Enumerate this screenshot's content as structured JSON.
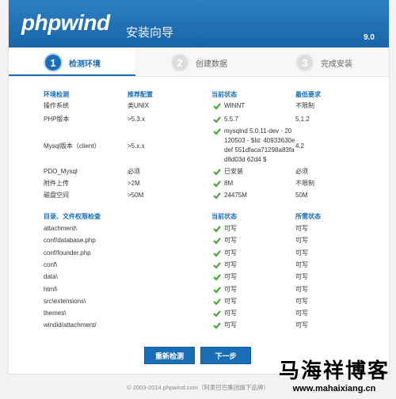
{
  "header": {
    "logo": "phpwind",
    "title": "安装向导",
    "version": "9.0"
  },
  "steps": [
    {
      "num": "1",
      "label": "检测环境"
    },
    {
      "num": "2",
      "label": "创建数据"
    },
    {
      "num": "3",
      "label": "完成安装"
    }
  ],
  "env": {
    "headers": [
      "环境检测",
      "推荐配置",
      "当前状态",
      "最低要求"
    ],
    "rows": [
      {
        "name": "操作系统",
        "rec": "类UNIX",
        "cur": "WINNT",
        "min": "不限制"
      },
      {
        "name": "PHP版本",
        "rec": ">5.3.x",
        "cur": "5.5.7",
        "min": "5.1.2"
      },
      {
        "name": "Mysql版本（client）",
        "rec": ">5.x.x",
        "cur": "mysqlnd 5.0.11-dev - 20 120503 - $Id: 40933630edef 551dfaca71298a83fad8d03d 62d4 $",
        "min": "4.2"
      },
      {
        "name": "PDO_Mysql",
        "rec": "必须",
        "cur": "已安装",
        "min": "必须"
      },
      {
        "name": "附件上传",
        "rec": ">2M",
        "cur": "8M",
        "min": "不限制"
      },
      {
        "name": "磁盘空间",
        "rec": ">50M",
        "cur": "24475M",
        "min": "50M"
      }
    ]
  },
  "perm": {
    "headers": [
      "目录、文件权限检查",
      "当前状态",
      "所需状态"
    ],
    "rows": [
      {
        "path": "attachment\\",
        "cur": "可写",
        "req": "可写"
      },
      {
        "path": "conf/database.php",
        "cur": "可写",
        "req": "可写"
      },
      {
        "path": "conf/founder.php",
        "cur": "可写",
        "req": "可写"
      },
      {
        "path": "conf\\",
        "cur": "可写",
        "req": "可写"
      },
      {
        "path": "data\\",
        "cur": "可写",
        "req": "可写"
      },
      {
        "path": "html\\",
        "cur": "可写",
        "req": "可写"
      },
      {
        "path": "src\\extensions\\",
        "cur": "可写",
        "req": "可写"
      },
      {
        "path": "themes\\",
        "cur": "可写",
        "req": "可写"
      },
      {
        "path": "windid/attachment/",
        "cur": "可写",
        "req": "可写"
      }
    ]
  },
  "buttons": {
    "recheck": "重新检测",
    "next": "下一步"
  },
  "footer": "© 2003-2014 phpwind.com（阿里巴巴集团旗下品牌）",
  "watermark": {
    "name": "马海祥博客",
    "url": "www.mahaixiang.cn"
  },
  "colors": {
    "accent": "#1a6eb8",
    "check": "#4aa83a"
  }
}
